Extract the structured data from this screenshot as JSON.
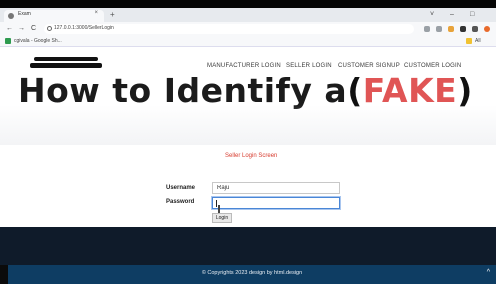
{
  "browser": {
    "tab_title": "Exam",
    "tab_close": "×",
    "new_tab": "+",
    "window_controls": [
      "˅",
      "–",
      "□"
    ],
    "nav_back": "←",
    "nav_forward": "→",
    "nav_reload": "C",
    "url": "127.0.0.1:3000/SellerLogin",
    "bookmarks": [
      "cgivala - Google Sh...",
      "All Bookm"
    ]
  },
  "nav": {
    "menu": [
      "MANUFACTURER LOGIN",
      "SELLER LOGIN",
      "CUSTOMER SIGNUP",
      "CUSTOMER LOGIN"
    ]
  },
  "hero": {
    "text_main": "How to Identify a",
    "bracket_open": "(",
    "text_fake": "FAKE",
    "bracket_close": ")"
  },
  "form": {
    "title": "Seller Login Screen",
    "username_label": "Username",
    "username_value": "Raju",
    "password_label": "Password",
    "password_value": "",
    "login_label": "Login"
  },
  "footer": {
    "copyright": "© Copyrights 2023 design by html.design",
    "up_icon": "^"
  }
}
